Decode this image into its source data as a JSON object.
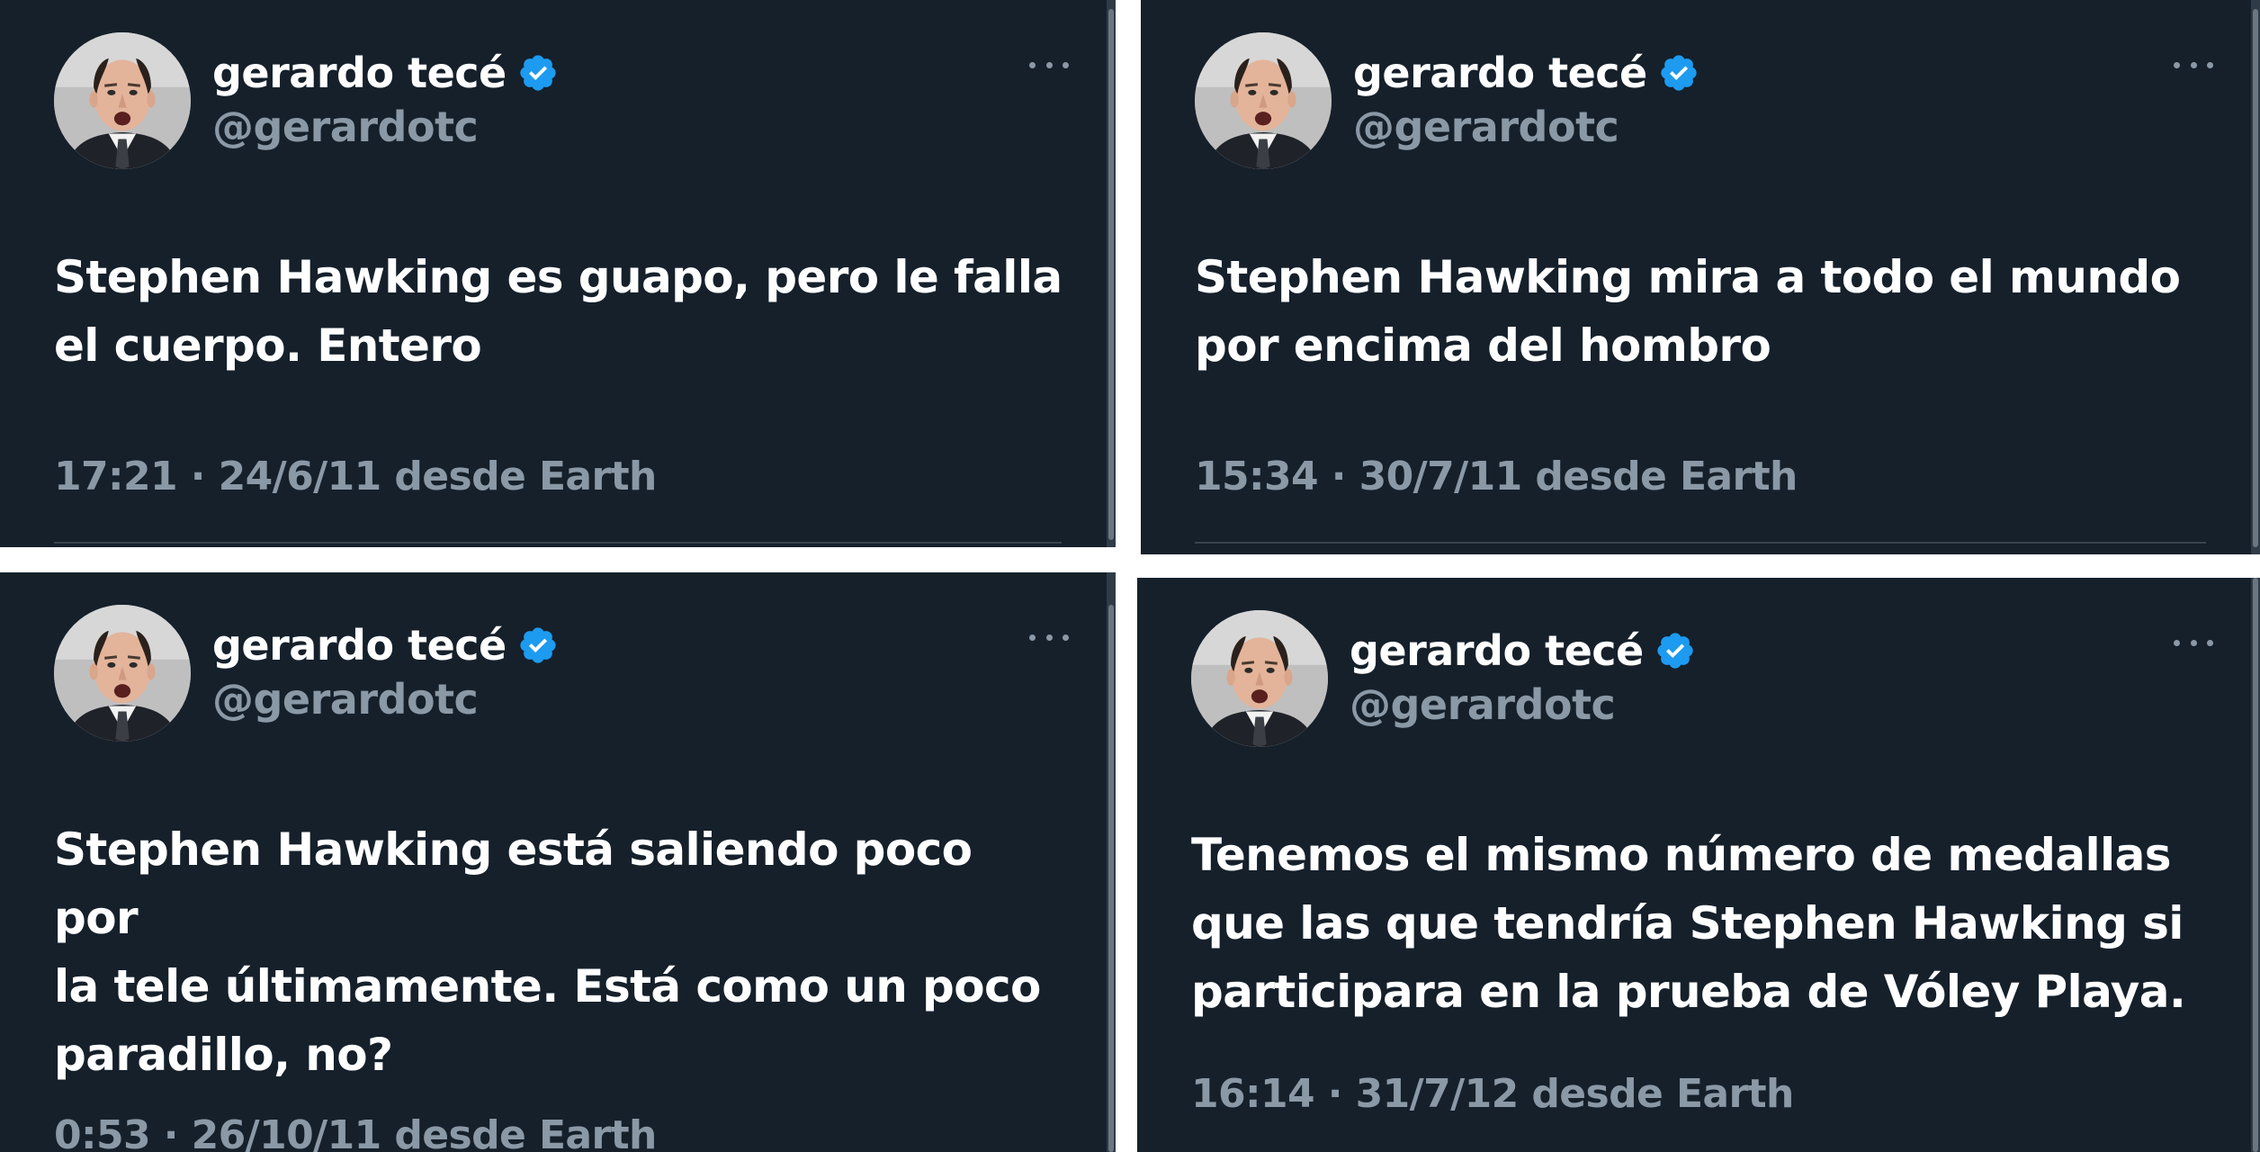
{
  "colors": {
    "background": "#15202b",
    "text_primary": "#ffffff",
    "text_secondary": "#8b98a5",
    "verified_badge": "#1d9bf0",
    "divider": "#38444d"
  },
  "icons": {
    "verified": "verified-badge-icon",
    "more": "more-options-icon",
    "avatar": "profile-avatar"
  },
  "tweets": [
    {
      "display_name": "gerardo tecé",
      "handle": "@gerardotc",
      "text": "Stephen Hawking es guapo, pero le falla\nel cuerpo. Entero",
      "time": "17:21",
      "date": "24/6/11",
      "source": "desde Earth"
    },
    {
      "display_name": "gerardo tecé",
      "handle": "@gerardotc",
      "text": "Stephen Hawking mira a todo el mundo\npor encima del hombro",
      "time": "15:34",
      "date": "30/7/11",
      "source": "desde Earth"
    },
    {
      "display_name": "gerardo tecé",
      "handle": "@gerardotc",
      "text": "Stephen Hawking está saliendo poco por\nla tele últimamente. Está como un poco\nparadillo, no?",
      "time": "0:53",
      "date": "26/10/11",
      "source": "desde Earth"
    },
    {
      "display_name": "gerardo tecé",
      "handle": "@gerardotc",
      "text": "Tenemos el mismo número de medallas\nque las que tendría Stephen Hawking si\nparticipara en la prueba de Vóley Playa.",
      "time": "16:14",
      "date": "31/7/12",
      "source": "desde Earth"
    }
  ]
}
